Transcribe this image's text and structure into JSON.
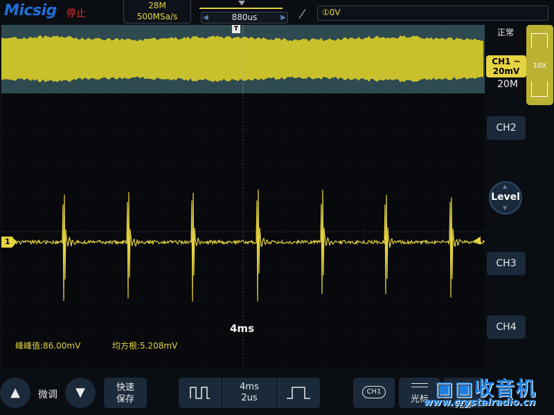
{
  "header": {
    "brand": "Micsig",
    "run_state": "停止",
    "memory_depth": "28M",
    "sample_rate": "500MSa/s",
    "trigger_position": "880us",
    "trigger_level": "①0V"
  },
  "overview": {
    "status": "正常"
  },
  "channel1": {
    "name": "CH1 ~",
    "scale": "20mV",
    "bandwidth": "20M",
    "probe": "10X",
    "color": "#e6d341",
    "marker": "1"
  },
  "right_panel": {
    "ch2": "CH2",
    "level": "Level",
    "ch3": "CH3",
    "ch4": "CH4"
  },
  "screen": {
    "timebase_label": "4ms",
    "measurements": [
      {
        "label": "峰峰值:86.00mV"
      },
      {
        "label": "均方根:5.208mV"
      }
    ]
  },
  "bottom": {
    "fine_label": "微调",
    "quick_save": [
      "快速",
      "保存"
    ],
    "timebase_main": "4ms",
    "timebase_zoom": "2us",
    "ch1_chip": "CH1",
    "cursor": "光标",
    "cursor2": "光标",
    "watermark": "收音机",
    "watermark_url": "www.crystalradio.cn"
  },
  "colors": {
    "accent": "#1e6fd9",
    "trace": "#e6d341",
    "grid": "#2a3440",
    "panel": "#1a2a3a"
  }
}
